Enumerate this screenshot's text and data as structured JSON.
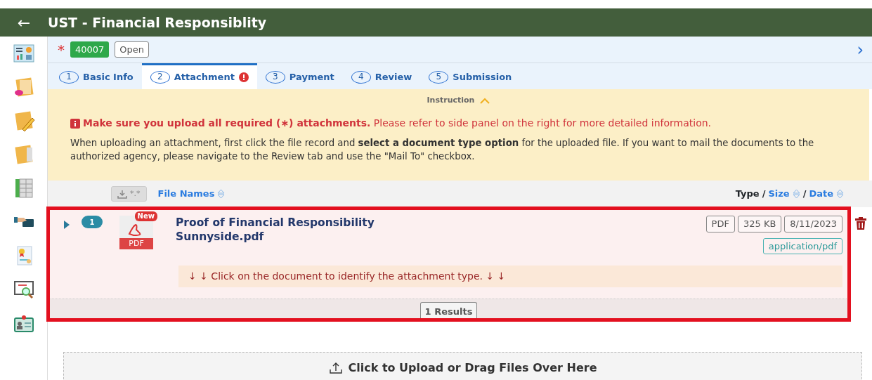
{
  "header": {
    "back": "←",
    "title": "UST - Financial Responsiblity"
  },
  "sidebar": {
    "items": [
      {
        "kind": "dashboard"
      },
      {
        "kind": "new-doc"
      },
      {
        "kind": "edit-doc"
      },
      {
        "kind": "doc"
      },
      {
        "kind": "ledger"
      },
      {
        "kind": "payment"
      },
      {
        "kind": "certificate"
      },
      {
        "kind": "inspect"
      },
      {
        "kind": "badge"
      }
    ]
  },
  "record": {
    "required": "*",
    "id": "40007",
    "status": "Open",
    "next": "›"
  },
  "tabs": [
    {
      "number": "1",
      "label": "Basic Info",
      "selected": false,
      "error": false
    },
    {
      "number": "2",
      "label": "Attachment",
      "selected": true,
      "error": true
    },
    {
      "number": "3",
      "label": "Payment",
      "selected": false,
      "error": false
    },
    {
      "number": "4",
      "label": "Review",
      "selected": false,
      "error": false
    },
    {
      "number": "5",
      "label": "Submission",
      "selected": false,
      "error": false
    }
  ],
  "instruction": {
    "title": "Instruction",
    "expanded": true,
    "warning": "**Make sure you upload all required (∗) attachments.** Please refer to side panel on the right for more detailed information.",
    "text": "When uploading an attachment, first click the file record and **select a document type option** for the uploaded file. If you want to mail the documents to the authorized agency, please navigate to the Review tab and use the \"Mail To\" checkbox."
  },
  "columns": {
    "download_label": "*.*",
    "left": [
      {
        "label": "File Names",
        "sortable": true
      }
    ],
    "right": [
      {
        "label": "Type",
        "sortable": false
      },
      {
        "label": "Size",
        "sortable": true
      },
      {
        "label": "Date",
        "sortable": true
      }
    ],
    "separator": "/"
  },
  "files": [
    {
      "index": "1",
      "expanded": false,
      "is_new": true,
      "new_label": "New",
      "icon_label": "PDF",
      "name": "Proof of Financial Responsibility Sunnyside.pdf",
      "type": "PDF",
      "size": "325 KB",
      "date": "8/11/2023",
      "mime": "application/pdf",
      "hint": "↓ ↓ Click on the document to identify the attachment type. ↓ ↓"
    }
  ],
  "results": "1 Results",
  "upload": "Click to Upload or Drag Files Over Here"
}
